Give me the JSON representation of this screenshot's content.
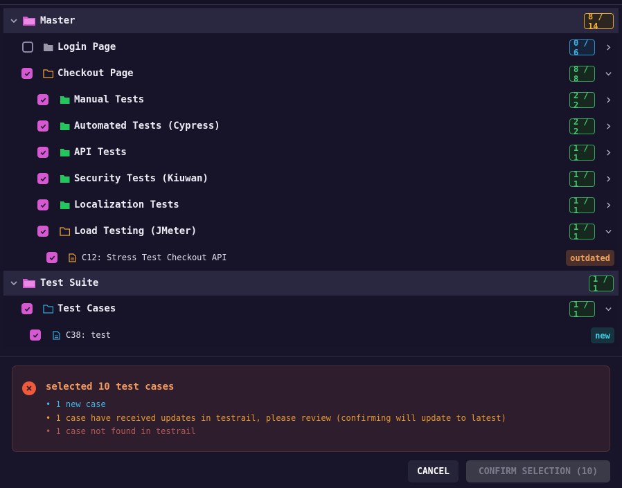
{
  "tree": {
    "master": {
      "title": "Master",
      "count": "8 / 14",
      "children": {
        "login": {
          "label": "Login Page",
          "count": "0 / 6"
        },
        "checkout": {
          "label": "Checkout Page",
          "count": "8 / 8",
          "children": {
            "manual": {
              "label": "Manual Tests",
              "count": "2 / 2"
            },
            "automated": {
              "label": "Automated Tests (Cypress)",
              "count": "2 / 2"
            },
            "api": {
              "label": "API Tests",
              "count": "1 / 1"
            },
            "security": {
              "label": "Security Tests (Kiuwan)",
              "count": "1 / 1"
            },
            "localization": {
              "label": "Localization Tests",
              "count": "1 / 1"
            },
            "load": {
              "label": "Load Testing (JMeter)",
              "count": "1 / 1",
              "case": {
                "label": "C12: Stress Test Checkout API",
                "status": "outdated"
              }
            }
          }
        }
      }
    },
    "suite": {
      "title": "Test Suite",
      "count": "1 / 1",
      "children": {
        "cases": {
          "label": "Test Cases",
          "count": "1 / 1",
          "case": {
            "label": "C38: test",
            "status": "new"
          }
        }
      }
    }
  },
  "alert": {
    "title": "selected 10 test cases",
    "lines": [
      "• 1 new case",
      "• 1 case have received updates in testrail, please review (confirming will update to latest)",
      "• 1 case not found in testrail"
    ]
  },
  "actions": {
    "cancel": "CANCEL",
    "confirm": "CONFIRM SELECTION (10)"
  },
  "colors": {
    "checkbox": "#d759d1",
    "folder_pink": "#d759d1",
    "folder_green": "#22c55e",
    "folder_amber": "#e8a23a",
    "folder_blue": "#2fa5d6",
    "error": "#ef5b3a"
  }
}
